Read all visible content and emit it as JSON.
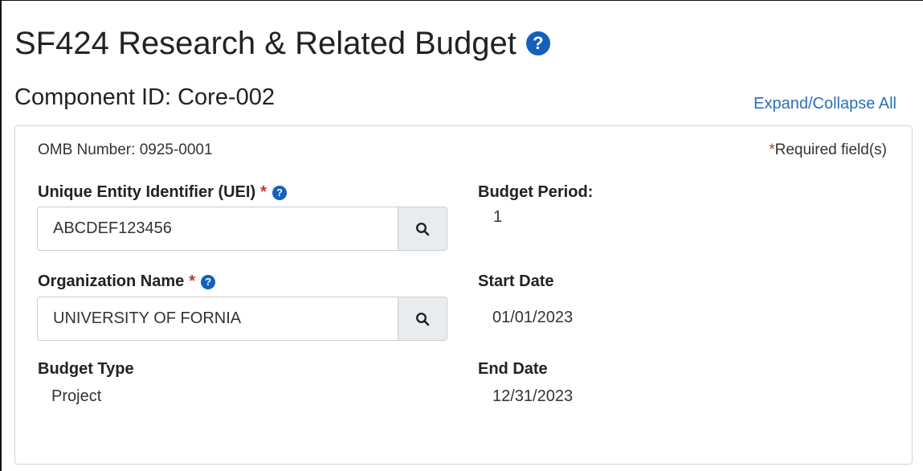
{
  "header": {
    "title": "SF424 Research & Related Budget",
    "help_icon_glyph": "?",
    "component_id": "Component ID: Core-002",
    "expand_collapse_label": "Expand/Collapse All"
  },
  "form": {
    "omb_number": "OMB Number: 0925-0001",
    "required_star": "*",
    "required_note": "Required field(s)",
    "uei": {
      "label": "Unique Entity Identifier (UEI)",
      "required_marker": "*",
      "value": "ABCDEF123456",
      "icon": "search-icon"
    },
    "organization": {
      "label": "Organization Name",
      "required_marker": "*",
      "value": "UNIVERSITY OF FORNIA",
      "icon": "search-icon"
    },
    "budget_type": {
      "label": "Budget Type",
      "value": "Project"
    },
    "budget_period": {
      "label": "Budget Period:",
      "value": "1"
    },
    "start_date": {
      "label": "Start Date",
      "value": "01/01/2023"
    },
    "end_date": {
      "label": "End Date",
      "value": "12/31/2023"
    }
  },
  "colors": {
    "accent": "#1560bd",
    "link": "#2a6fb8",
    "required": "#c0392b",
    "button_bg": "#e9ecef"
  }
}
